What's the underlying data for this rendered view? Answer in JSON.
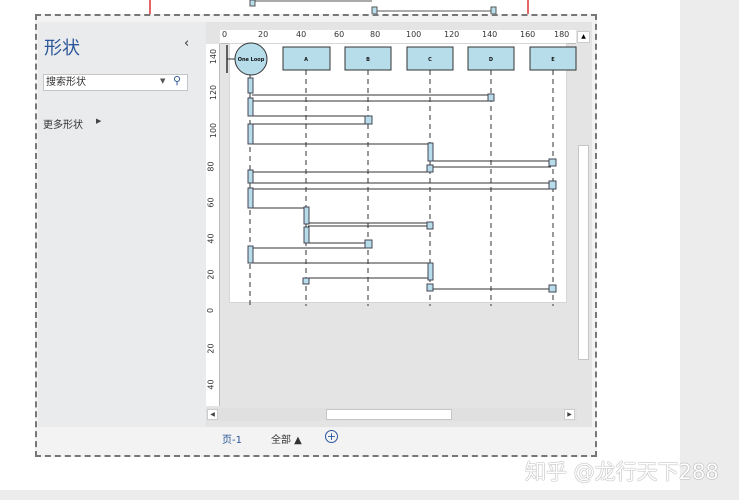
{
  "shapes_panel": {
    "title": "形状",
    "collapse_icon": "chevron-left-icon",
    "search_placeholder": "搜索形状",
    "more_shapes": "更多形状"
  },
  "rulers": {
    "horizontal": [
      "0",
      "20",
      "40",
      "60",
      "80",
      "100",
      "120",
      "140",
      "160",
      "180"
    ],
    "vertical": [
      "140",
      "120",
      "100",
      "80",
      "60",
      "40",
      "20",
      "0",
      "20",
      "40"
    ]
  },
  "diagram": {
    "loop_label": "One Loop",
    "lifelines": [
      "A",
      "B",
      "C",
      "D",
      "E"
    ]
  },
  "tabs": {
    "page": "页-1",
    "all": "全部 ▲",
    "add": "+"
  },
  "watermark": "知乎 @龙行天下288",
  "colors": {
    "accent": "#2b579a",
    "shape_fill": "#b7dcea"
  }
}
